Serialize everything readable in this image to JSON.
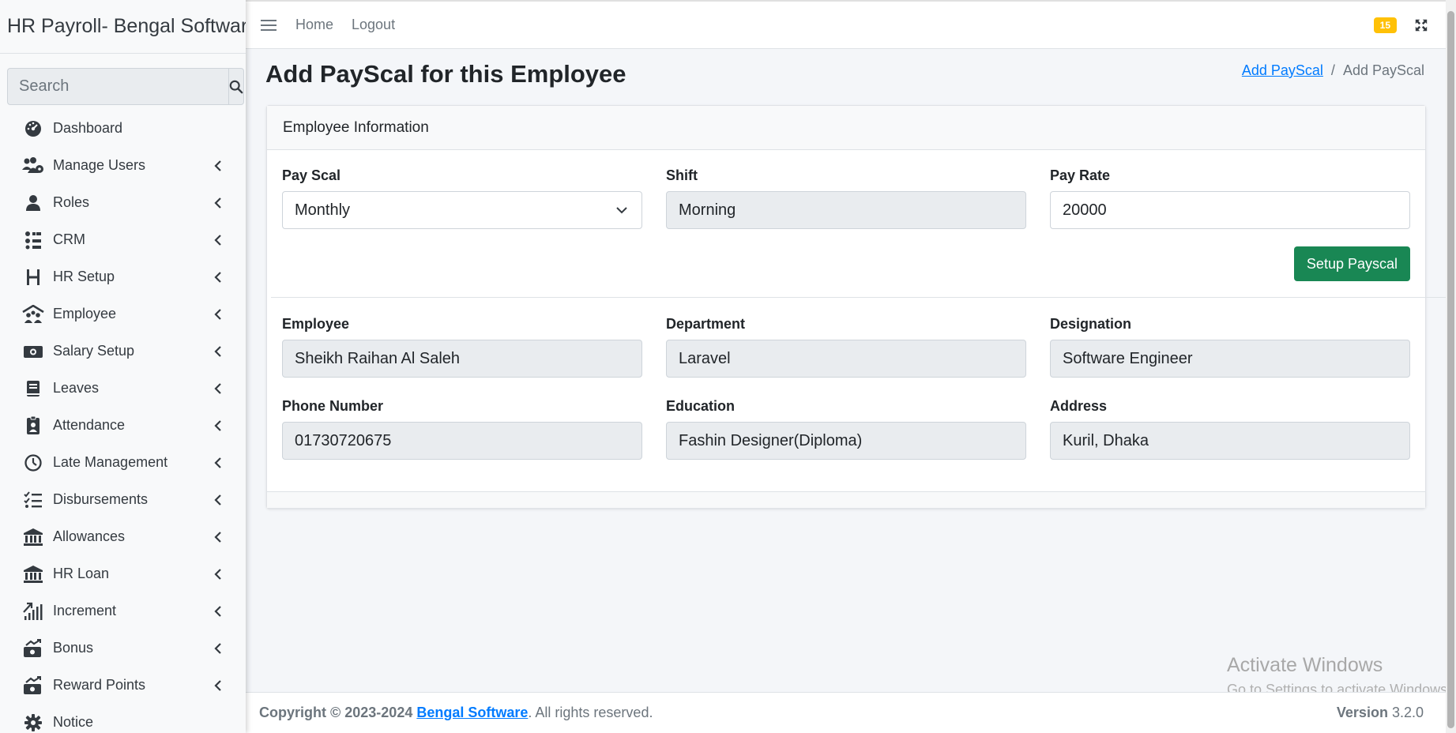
{
  "brand": {
    "title": "HR Payroll- Bengal Software"
  },
  "search": {
    "placeholder": "Search"
  },
  "sidebar": {
    "items": [
      {
        "label": "Dashboard",
        "icon": "dashboard-icon",
        "chevron": false
      },
      {
        "label": "Manage Users",
        "icon": "users-gear-icon",
        "chevron": true
      },
      {
        "label": "Roles",
        "icon": "user-icon",
        "chevron": true
      },
      {
        "label": "CRM",
        "icon": "crm-icon",
        "chevron": true
      },
      {
        "label": "HR Setup",
        "icon": "h-letter-icon",
        "chevron": true
      },
      {
        "label": "Employee",
        "icon": "people-roof-icon",
        "chevron": true
      },
      {
        "label": "Salary Setup",
        "icon": "money-bill-icon",
        "chevron": true
      },
      {
        "label": "Leaves",
        "icon": "book-icon",
        "chevron": true
      },
      {
        "label": "Attendance",
        "icon": "id-badge-icon",
        "chevron": true
      },
      {
        "label": "Late Management",
        "icon": "clock-icon",
        "chevron": true
      },
      {
        "label": "Disbursements",
        "icon": "list-check-icon",
        "chevron": true
      },
      {
        "label": "Allowances",
        "icon": "bank-icon",
        "chevron": true
      },
      {
        "label": "HR Loan",
        "icon": "bank-icon",
        "chevron": true
      },
      {
        "label": "Increment",
        "icon": "chart-arrow-icon",
        "chevron": true
      },
      {
        "label": "Bonus",
        "icon": "money-chart-icon",
        "chevron": true
      },
      {
        "label": "Reward Points",
        "icon": "money-chart-icon",
        "chevron": true
      },
      {
        "label": "Notice",
        "icon": "gear-icon",
        "chevron": false
      }
    ]
  },
  "topbar": {
    "home": "Home",
    "logout": "Logout",
    "badge": "15"
  },
  "page": {
    "title": "Add PayScal for this Employee",
    "breadcrumb_link": "Add PayScal",
    "breadcrumb_sep": "/",
    "breadcrumb_current": "Add PayScal"
  },
  "card": {
    "header": "Employee Information",
    "pay_scal": {
      "label": "Pay Scal",
      "value": "Monthly"
    },
    "shift": {
      "label": "Shift",
      "value": "Morning"
    },
    "pay_rate": {
      "label": "Pay Rate",
      "value": "20000"
    },
    "setup_button": "Setup Payscal",
    "employee": {
      "label": "Employee",
      "value": "Sheikh Raihan Al Saleh"
    },
    "department": {
      "label": "Department",
      "value": "Laravel"
    },
    "designation": {
      "label": "Designation",
      "value": "Software Engineer"
    },
    "phone": {
      "label": "Phone Number",
      "value": "01730720675"
    },
    "education": {
      "label": "Education",
      "value": "Fashin Designer(Diploma)"
    },
    "address": {
      "label": "Address",
      "value": "Kuril, Dhaka"
    }
  },
  "watermark": {
    "title": "Activate Windows",
    "subtitle": "Go to Settings to activate Windows."
  },
  "footer": {
    "copyright": "Copyright © 2023-2024",
    "company": "Bengal Software",
    "rights": ". All rights reserved.",
    "version_label": "Version",
    "version": "3.2.0"
  },
  "colors": {
    "accent": "#007bff",
    "button_success": "#198754",
    "badge_warning": "#ffc107"
  }
}
